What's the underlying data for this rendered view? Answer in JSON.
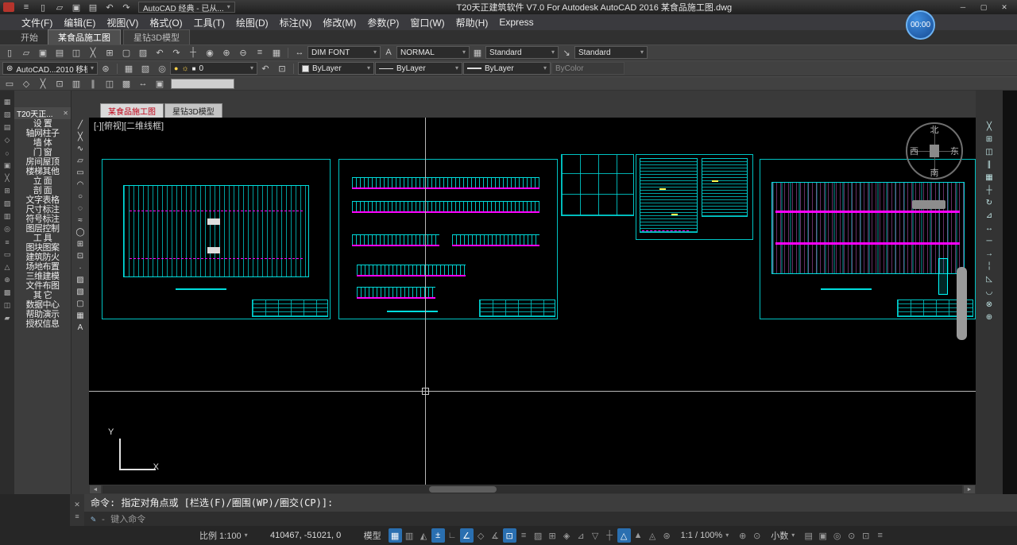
{
  "ui": {
    "caret": "▾",
    "close": "✕",
    "menu": "≡",
    "pencil": "✎",
    "dash": "-",
    "left_arrow": "◄",
    "right_arrow": "►"
  },
  "colors": {
    "canvas_line_cyan": "#00e5e5",
    "highlight_magenta": "#ff00ff",
    "active_tab_red": "#c00016",
    "status_active_blue": "#2a6fb0",
    "timer_blue": "#2f7fe0"
  },
  "window": {
    "title": "T20天正建筑软件 V7.0 For Autodesk AutoCAD 2016   某食品施工图.dwg",
    "controls": {
      "minimize": "─",
      "maximize": "▢",
      "close": "✕"
    }
  },
  "quick_access": {
    "workspace_label": "AutoCAD 经典 - 已从...",
    "icons": [
      {
        "name": "app-menu-icon",
        "glyph": "≡"
      },
      {
        "name": "qnew-icon",
        "glyph": "▯"
      },
      {
        "name": "open-icon",
        "glyph": "▱"
      },
      {
        "name": "save-icon",
        "glyph": "▣"
      },
      {
        "name": "plot-icon",
        "glyph": "▤"
      },
      {
        "name": "undo-icon",
        "glyph": "↶"
      },
      {
        "name": "redo-icon",
        "glyph": "↷"
      }
    ]
  },
  "recording_timer": "00:00",
  "menu_bar": {
    "items": [
      "文件(F)",
      "编辑(E)",
      "视图(V)",
      "格式(O)",
      "工具(T)",
      "绘图(D)",
      "标注(N)",
      "修改(M)",
      "参数(P)",
      "窗口(W)",
      "帮助(H)",
      "Express"
    ]
  },
  "file_tabs": {
    "start": "开始",
    "tabs": [
      {
        "label": "某食品施工图",
        "active": true
      },
      {
        "label": "星钻3D模型",
        "active": false
      }
    ]
  },
  "toolbar_a": {
    "icons": [
      {
        "name": "qnew-icon",
        "glyph": "▯"
      },
      {
        "name": "open-icon",
        "glyph": "▱"
      },
      {
        "name": "save-icon",
        "glyph": "▣"
      },
      {
        "name": "plot-icon",
        "glyph": "▤"
      },
      {
        "name": "plot-preview-icon",
        "glyph": "◫"
      },
      {
        "name": "cut-icon",
        "glyph": "╳"
      },
      {
        "name": "copy-icon",
        "glyph": "⊞"
      },
      {
        "name": "paste-icon",
        "glyph": "▢"
      },
      {
        "name": "match-properties-icon",
        "glyph": "▨"
      },
      {
        "name": "undo-icon",
        "glyph": "↶"
      },
      {
        "name": "redo-icon",
        "glyph": "↷"
      },
      {
        "name": "pan-icon",
        "glyph": "┼"
      },
      {
        "name": "zoom-realtime-icon",
        "glyph": "◉"
      },
      {
        "name": "zoom-window-icon",
        "glyph": "⊕"
      },
      {
        "name": "zoom-previous-icon",
        "glyph": "⊖"
      },
      {
        "name": "properties-icon",
        "glyph": "≡"
      },
      {
        "name": "designcenter-icon",
        "glyph": "▦"
      }
    ]
  },
  "toolbar_styles": {
    "dim": {
      "icon": "↔",
      "label": "DIM FONT"
    },
    "text": {
      "icon": "A",
      "label": "NORMAL"
    },
    "table": {
      "icon": "▦",
      "label": "Standard"
    },
    "mleader": {
      "icon": "↘",
      "label": "Standard"
    }
  },
  "workspace_toolbar": {
    "icon": "⊛",
    "label": "AutoCAD...2010 移植",
    "gear": "⊛"
  },
  "layers_toolbar": {
    "icons": [
      {
        "name": "layer-properties-icon",
        "glyph": "▦"
      },
      {
        "name": "layer-states-icon",
        "glyph": "▧"
      },
      {
        "name": "layer-isolate-icon",
        "glyph": "◎"
      }
    ],
    "status_glyphs": {
      "bulb": "●",
      "sun": "☼",
      "swatch": "■"
    },
    "current": "0",
    "post_icons": [
      {
        "name": "layer-previous-icon",
        "glyph": "↶"
      },
      {
        "name": "layer-match-icon",
        "glyph": "⊡"
      }
    ]
  },
  "properties_toolbar": {
    "color_label": "ByLayer",
    "linetype_label": "ByLayer",
    "lineweight_label": "ByLayer",
    "plot_label": "ByColor"
  },
  "toolbar_c": {
    "icons": [
      {
        "name": "tool-icon",
        "glyph": "▭"
      },
      {
        "name": "tool-icon",
        "glyph": "◇"
      },
      {
        "name": "tool-icon",
        "glyph": "╳"
      },
      {
        "name": "tool-icon",
        "glyph": "⊡"
      },
      {
        "name": "tool-icon",
        "glyph": "▥"
      },
      {
        "name": "tool-icon",
        "glyph": "∥"
      },
      {
        "name": "tool-icon",
        "glyph": "◫"
      },
      {
        "name": "tool-icon",
        "glyph": "▩"
      },
      {
        "name": "tool-icon",
        "glyph": "↔"
      },
      {
        "name": "tool-icon",
        "glyph": "▣"
      }
    ]
  },
  "left_dock": {
    "icons": [
      {
        "name": "dock-icon",
        "glyph": "▦"
      },
      {
        "name": "dock-icon",
        "glyph": "▧"
      },
      {
        "name": "dock-icon",
        "glyph": "▤"
      },
      {
        "name": "dock-icon",
        "glyph": "◇"
      },
      {
        "name": "dock-icon",
        "glyph": "○"
      },
      {
        "name": "dock-icon",
        "glyph": "▣"
      },
      {
        "name": "dock-icon",
        "glyph": "╳"
      },
      {
        "name": "dock-icon",
        "glyph": "⊞"
      },
      {
        "name": "dock-icon",
        "glyph": "▨"
      },
      {
        "name": "dock-icon",
        "glyph": "▥"
      },
      {
        "name": "dock-icon",
        "glyph": "◎"
      },
      {
        "name": "dock-icon",
        "glyph": "≡"
      },
      {
        "name": "dock-icon",
        "glyph": "▭"
      },
      {
        "name": "dock-icon",
        "glyph": "△"
      },
      {
        "name": "dock-icon",
        "glyph": "⊕"
      },
      {
        "name": "dock-icon",
        "glyph": "▩"
      },
      {
        "name": "dock-icon",
        "glyph": "◫"
      },
      {
        "name": "dock-icon",
        "glyph": "▰"
      }
    ]
  },
  "sidebar": {
    "panel_title": "T20天正...",
    "items": [
      "设  置",
      "轴网柱子",
      "墙  体",
      "门  窗",
      "房间屋顶",
      "楼梯其他",
      "立  面",
      "剖  面",
      "文字表格",
      "尺寸标注",
      "符号标注",
      "图层控制",
      "工  具",
      "图块图案",
      "建筑防火",
      "场地布置",
      "三维建模",
      "文件布图",
      "其  它",
      "数据中心",
      "帮助演示",
      "授权信息"
    ]
  },
  "draw_toolbar": {
    "icons": [
      {
        "name": "line-icon",
        "glyph": "╱"
      },
      {
        "name": "construction-line-icon",
        "glyph": "╳"
      },
      {
        "name": "polyline-icon",
        "glyph": "∿"
      },
      {
        "name": "polygon-icon",
        "glyph": "▱"
      },
      {
        "name": "rectangle-icon",
        "glyph": "▭"
      },
      {
        "name": "arc-icon",
        "glyph": "◠"
      },
      {
        "name": "circle-icon",
        "glyph": "○"
      },
      {
        "name": "revision-cloud-icon",
        "glyph": "◌"
      },
      {
        "name": "spline-icon",
        "glyph": "≈"
      },
      {
        "name": "ellipse-icon",
        "glyph": "◯"
      },
      {
        "name": "insert-block-icon",
        "glyph": "⊞"
      },
      {
        "name": "make-block-icon",
        "glyph": "⊡"
      },
      {
        "name": "point-icon",
        "glyph": "∙"
      },
      {
        "name": "hatch-icon",
        "glyph": "▨"
      },
      {
        "name": "gradient-icon",
        "glyph": "▧"
      },
      {
        "name": "region-icon",
        "glyph": "▢"
      },
      {
        "name": "table-icon",
        "glyph": "▦"
      },
      {
        "name": "mtext-icon",
        "glyph": "A"
      }
    ]
  },
  "modify_toolbar": {
    "icons": [
      {
        "name": "erase-icon",
        "glyph": "╳"
      },
      {
        "name": "copy-icon",
        "glyph": "⊞"
      },
      {
        "name": "mirror-icon",
        "glyph": "◫"
      },
      {
        "name": "offset-icon",
        "glyph": "∥"
      },
      {
        "name": "array-icon",
        "glyph": "▦"
      },
      {
        "name": "move-icon",
        "glyph": "┼"
      },
      {
        "name": "rotate-icon",
        "glyph": "↻"
      },
      {
        "name": "scale-icon",
        "glyph": "⊿"
      },
      {
        "name": "stretch-icon",
        "glyph": "↔"
      },
      {
        "name": "trim-icon",
        "glyph": "─"
      },
      {
        "name": "extend-icon",
        "glyph": "→"
      },
      {
        "name": "break-icon",
        "glyph": "╎"
      },
      {
        "name": "chamfer-icon",
        "glyph": "◺"
      },
      {
        "name": "fillet-icon",
        "glyph": "◡"
      },
      {
        "name": "explode-icon",
        "glyph": "⊗"
      },
      {
        "name": "join-icon",
        "glyph": "⊕"
      }
    ]
  },
  "drawing_tabs": {
    "tabs": [
      {
        "label": "某食品施工图",
        "active": true
      },
      {
        "label": "星钻3D模型",
        "active": false
      }
    ]
  },
  "canvas": {
    "viewport_label": "[-][俯视][二维线框]",
    "compass": {
      "north": "北",
      "south": "南",
      "east": "东",
      "west": "西"
    },
    "ucs": {
      "x": "X",
      "y": "Y"
    }
  },
  "command_line": {
    "prompt": "命令: 指定对角点或 [栏选(F)/圈围(WP)/圈交(CP)]:",
    "placeholder": "键入命令"
  },
  "status_bar": {
    "scale": "比例 1:100",
    "coordinates": "410467, -51021, 0",
    "model_label": "模型",
    "annotation_scale": "1:1 / 100%",
    "units": "小数",
    "toggle_icons": [
      {
        "name": "grid-display-icon",
        "glyph": "▦",
        "active": true
      },
      {
        "name": "snap-mode-icon",
        "glyph": "▥",
        "active": false
      },
      {
        "name": "infer-constraints-icon",
        "glyph": "◭",
        "active": false
      },
      {
        "name": "dynamic-input-icon",
        "glyph": "±",
        "active": true
      },
      {
        "name": "ortho-mode-icon",
        "glyph": "∟",
        "active": false
      },
      {
        "name": "polar-tracking-icon",
        "glyph": "∠",
        "active": true
      },
      {
        "name": "isometric-drafting-icon",
        "glyph": "◇",
        "active": false
      },
      {
        "name": "object-snap-tracking-icon",
        "glyph": "∡",
        "active": false
      },
      {
        "name": "object-snap-icon",
        "glyph": "⊡",
        "active": true
      },
      {
        "name": "lineweight-display-icon",
        "glyph": "≡",
        "active": false
      },
      {
        "name": "transparency-icon",
        "glyph": "▨",
        "active": false
      },
      {
        "name": "selection-cycling-icon",
        "glyph": "⊞",
        "active": false
      },
      {
        "name": "3d-object-snap-icon",
        "glyph": "◈",
        "active": false
      },
      {
        "name": "dynamic-ucs-icon",
        "glyph": "⊿",
        "active": false
      },
      {
        "name": "selection-filtering-icon",
        "glyph": "▽",
        "active": false
      },
      {
        "name": "gizmo-icon",
        "glyph": "┼",
        "active": false
      },
      {
        "name": "annotation-visibility-icon",
        "glyph": "△",
        "active": true
      },
      {
        "name": "autoscale-icon",
        "glyph": "▲",
        "active": false
      },
      {
        "name": "annotation-monitor-icon",
        "glyph": "◬",
        "active": false
      },
      {
        "name": "workspace-switching-icon",
        "glyph": "⊛",
        "active": false
      }
    ],
    "mid_icons": [
      {
        "name": "annotation-scale-sync-icon",
        "glyph": "⊕"
      },
      {
        "name": "hardware-acceleration-icon",
        "glyph": "⊙"
      }
    ],
    "right_icons": [
      {
        "name": "quick-properties-icon",
        "glyph": "▤"
      },
      {
        "name": "lock-ui-icon",
        "glyph": "▣"
      },
      {
        "name": "isolate-objects-icon",
        "glyph": "◎"
      },
      {
        "name": "graphics-performance-icon",
        "glyph": "⊙"
      },
      {
        "name": "clean-screen-icon",
        "glyph": "⊡"
      },
      {
        "name": "customization-menu-icon",
        "glyph": "≡"
      }
    ]
  }
}
